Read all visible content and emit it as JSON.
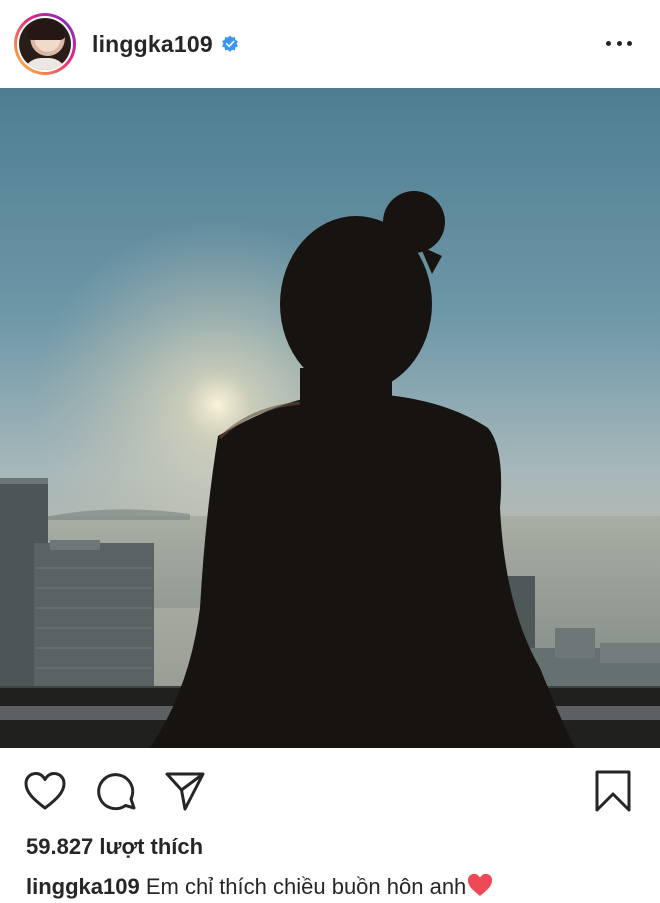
{
  "post": {
    "username": "linggka109",
    "verified": true,
    "likes_text": "59.827 lượt thích",
    "caption_text": "Em chỉ thích chiều buồn hôn anh",
    "caption_emoji": "❤️"
  },
  "icons": {
    "verified": "verified-badge-icon",
    "more": "more-options-icon",
    "like": "heart-icon",
    "comment": "comment-icon",
    "share": "paper-plane-icon",
    "save": "bookmark-icon"
  },
  "colors": {
    "verified_blue": "#3897f0",
    "heart_red": "#ed4956"
  }
}
